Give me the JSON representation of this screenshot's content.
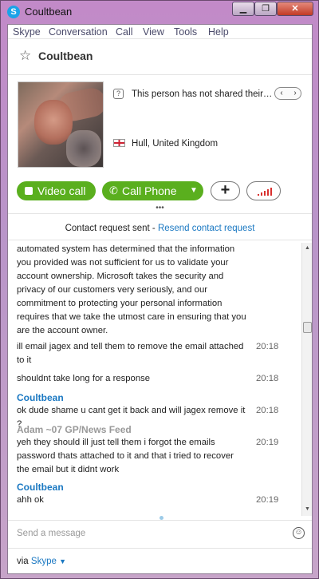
{
  "window": {
    "title": "Coultbean",
    "minimize": "▁",
    "maximize": "❐",
    "close": "✕"
  },
  "menu": [
    "Skype",
    "Conversation",
    "Call",
    "View",
    "Tools",
    "Help"
  ],
  "header": {
    "contact_name": "Coultbean"
  },
  "profile": {
    "mood_text": "This person has not shared their…",
    "location": "Hull, United Kingdom",
    "prev_arrow": "‹",
    "next_arrow": "›"
  },
  "actions": {
    "video_call": "Video call",
    "call_phone": "Call Phone",
    "call_phone_caret": "▼",
    "add": "+"
  },
  "request": {
    "sent_text": "Contact request sent - ",
    "resend_link": "Resend contact request"
  },
  "chat": {
    "intro_lines": [
      "automated system has determined that the information",
      "you provided was not sufficient for us to validate your",
      "account ownership.  Microsoft takes the security and",
      "privacy of our customers very seriously, and our",
      "commitment to protecting your personal information",
      "requires that we take the utmost care in ensuring that you",
      "are the account owner."
    ],
    "messages": [
      {
        "text_lines": [
          "ill email jagex and tell them to remove the email attached",
          "to it"
        ],
        "time": "20:18"
      },
      {
        "text_lines": [
          "shouldnt take long for a response"
        ],
        "time": "20:18"
      },
      {
        "sender": "Coultbean",
        "text_lines": [
          "ok dude shame u cant get it back and will jagex remove it ?"
        ],
        "time": "20:18"
      },
      {
        "sender": "Adam ~07 GP/News Feed",
        "text_lines": [
          "yeh they should ill just tell them i forgot the emails",
          "password thats attached to it and that i tried to recover",
          "the email but it didnt work"
        ],
        "time": "20:19"
      },
      {
        "sender": "Coultbean",
        "text_lines": [
          "ahh ok"
        ],
        "time": "20:19"
      }
    ]
  },
  "compose": {
    "placeholder": "Send a message"
  },
  "footer": {
    "via": "via ",
    "skype": "Skype"
  }
}
